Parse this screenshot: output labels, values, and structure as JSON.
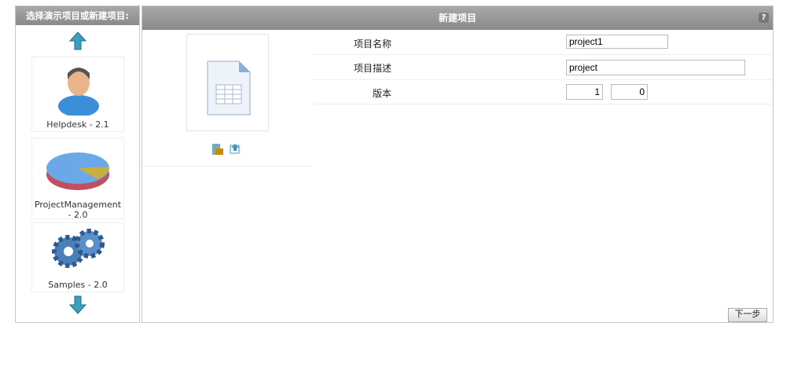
{
  "left_panel": {
    "title": "选择演示项目或新建项目:",
    "items": [
      {
        "label": "Helpdesk - 2.1"
      },
      {
        "label": "ProjectManagement - 2.0"
      },
      {
        "label": "Samples - 2.0"
      }
    ]
  },
  "right_panel": {
    "title": "新建项目",
    "help": "?",
    "form": {
      "name_label": "项目名称",
      "name_value": "project1",
      "desc_label": "项目描述",
      "desc_value": "project",
      "version_label": "版本",
      "version_major": "1",
      "version_minor": "0"
    },
    "next_label": "下一步"
  }
}
